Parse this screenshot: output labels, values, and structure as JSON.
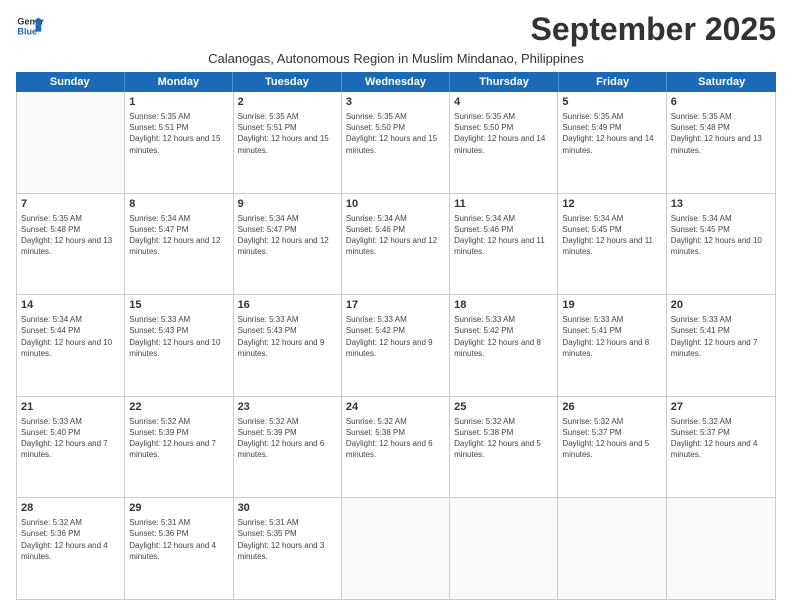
{
  "logo": {
    "line1": "General",
    "line2": "Blue"
  },
  "title": "September 2025",
  "subtitle": "Calanogas, Autonomous Region in Muslim Mindanao, Philippines",
  "header_days": [
    "Sunday",
    "Monday",
    "Tuesday",
    "Wednesday",
    "Thursday",
    "Friday",
    "Saturday"
  ],
  "weeks": [
    [
      {
        "day": "",
        "sunrise": "",
        "sunset": "",
        "daylight": ""
      },
      {
        "day": "1",
        "sunrise": "Sunrise: 5:35 AM",
        "sunset": "Sunset: 5:51 PM",
        "daylight": "Daylight: 12 hours and 15 minutes."
      },
      {
        "day": "2",
        "sunrise": "Sunrise: 5:35 AM",
        "sunset": "Sunset: 5:51 PM",
        "daylight": "Daylight: 12 hours and 15 minutes."
      },
      {
        "day": "3",
        "sunrise": "Sunrise: 5:35 AM",
        "sunset": "Sunset: 5:50 PM",
        "daylight": "Daylight: 12 hours and 15 minutes."
      },
      {
        "day": "4",
        "sunrise": "Sunrise: 5:35 AM",
        "sunset": "Sunset: 5:50 PM",
        "daylight": "Daylight: 12 hours and 14 minutes."
      },
      {
        "day": "5",
        "sunrise": "Sunrise: 5:35 AM",
        "sunset": "Sunset: 5:49 PM",
        "daylight": "Daylight: 12 hours and 14 minutes."
      },
      {
        "day": "6",
        "sunrise": "Sunrise: 5:35 AM",
        "sunset": "Sunset: 5:48 PM",
        "daylight": "Daylight: 12 hours and 13 minutes."
      }
    ],
    [
      {
        "day": "7",
        "sunrise": "Sunrise: 5:35 AM",
        "sunset": "Sunset: 5:48 PM",
        "daylight": "Daylight: 12 hours and 13 minutes."
      },
      {
        "day": "8",
        "sunrise": "Sunrise: 5:34 AM",
        "sunset": "Sunset: 5:47 PM",
        "daylight": "Daylight: 12 hours and 12 minutes."
      },
      {
        "day": "9",
        "sunrise": "Sunrise: 5:34 AM",
        "sunset": "Sunset: 5:47 PM",
        "daylight": "Daylight: 12 hours and 12 minutes."
      },
      {
        "day": "10",
        "sunrise": "Sunrise: 5:34 AM",
        "sunset": "Sunset: 5:46 PM",
        "daylight": "Daylight: 12 hours and 12 minutes."
      },
      {
        "day": "11",
        "sunrise": "Sunrise: 5:34 AM",
        "sunset": "Sunset: 5:46 PM",
        "daylight": "Daylight: 12 hours and 11 minutes."
      },
      {
        "day": "12",
        "sunrise": "Sunrise: 5:34 AM",
        "sunset": "Sunset: 5:45 PM",
        "daylight": "Daylight: 12 hours and 11 minutes."
      },
      {
        "day": "13",
        "sunrise": "Sunrise: 5:34 AM",
        "sunset": "Sunset: 5:45 PM",
        "daylight": "Daylight: 12 hours and 10 minutes."
      }
    ],
    [
      {
        "day": "14",
        "sunrise": "Sunrise: 5:34 AM",
        "sunset": "Sunset: 5:44 PM",
        "daylight": "Daylight: 12 hours and 10 minutes."
      },
      {
        "day": "15",
        "sunrise": "Sunrise: 5:33 AM",
        "sunset": "Sunset: 5:43 PM",
        "daylight": "Daylight: 12 hours and 10 minutes."
      },
      {
        "day": "16",
        "sunrise": "Sunrise: 5:33 AM",
        "sunset": "Sunset: 5:43 PM",
        "daylight": "Daylight: 12 hours and 9 minutes."
      },
      {
        "day": "17",
        "sunrise": "Sunrise: 5:33 AM",
        "sunset": "Sunset: 5:42 PM",
        "daylight": "Daylight: 12 hours and 9 minutes."
      },
      {
        "day": "18",
        "sunrise": "Sunrise: 5:33 AM",
        "sunset": "Sunset: 5:42 PM",
        "daylight": "Daylight: 12 hours and 8 minutes."
      },
      {
        "day": "19",
        "sunrise": "Sunrise: 5:33 AM",
        "sunset": "Sunset: 5:41 PM",
        "daylight": "Daylight: 12 hours and 8 minutes."
      },
      {
        "day": "20",
        "sunrise": "Sunrise: 5:33 AM",
        "sunset": "Sunset: 5:41 PM",
        "daylight": "Daylight: 12 hours and 7 minutes."
      }
    ],
    [
      {
        "day": "21",
        "sunrise": "Sunrise: 5:33 AM",
        "sunset": "Sunset: 5:40 PM",
        "daylight": "Daylight: 12 hours and 7 minutes."
      },
      {
        "day": "22",
        "sunrise": "Sunrise: 5:32 AM",
        "sunset": "Sunset: 5:39 PM",
        "daylight": "Daylight: 12 hours and 7 minutes."
      },
      {
        "day": "23",
        "sunrise": "Sunrise: 5:32 AM",
        "sunset": "Sunset: 5:39 PM",
        "daylight": "Daylight: 12 hours and 6 minutes."
      },
      {
        "day": "24",
        "sunrise": "Sunrise: 5:32 AM",
        "sunset": "Sunset: 5:38 PM",
        "daylight": "Daylight: 12 hours and 6 minutes."
      },
      {
        "day": "25",
        "sunrise": "Sunrise: 5:32 AM",
        "sunset": "Sunset: 5:38 PM",
        "daylight": "Daylight: 12 hours and 5 minutes."
      },
      {
        "day": "26",
        "sunrise": "Sunrise: 5:32 AM",
        "sunset": "Sunset: 5:37 PM",
        "daylight": "Daylight: 12 hours and 5 minutes."
      },
      {
        "day": "27",
        "sunrise": "Sunrise: 5:32 AM",
        "sunset": "Sunset: 5:37 PM",
        "daylight": "Daylight: 12 hours and 4 minutes."
      }
    ],
    [
      {
        "day": "28",
        "sunrise": "Sunrise: 5:32 AM",
        "sunset": "Sunset: 5:36 PM",
        "daylight": "Daylight: 12 hours and 4 minutes."
      },
      {
        "day": "29",
        "sunrise": "Sunrise: 5:31 AM",
        "sunset": "Sunset: 5:36 PM",
        "daylight": "Daylight: 12 hours and 4 minutes."
      },
      {
        "day": "30",
        "sunrise": "Sunrise: 5:31 AM",
        "sunset": "Sunset: 5:35 PM",
        "daylight": "Daylight: 12 hours and 3 minutes."
      },
      {
        "day": "",
        "sunrise": "",
        "sunset": "",
        "daylight": ""
      },
      {
        "day": "",
        "sunrise": "",
        "sunset": "",
        "daylight": ""
      },
      {
        "day": "",
        "sunrise": "",
        "sunset": "",
        "daylight": ""
      },
      {
        "day": "",
        "sunrise": "",
        "sunset": "",
        "daylight": ""
      }
    ]
  ]
}
